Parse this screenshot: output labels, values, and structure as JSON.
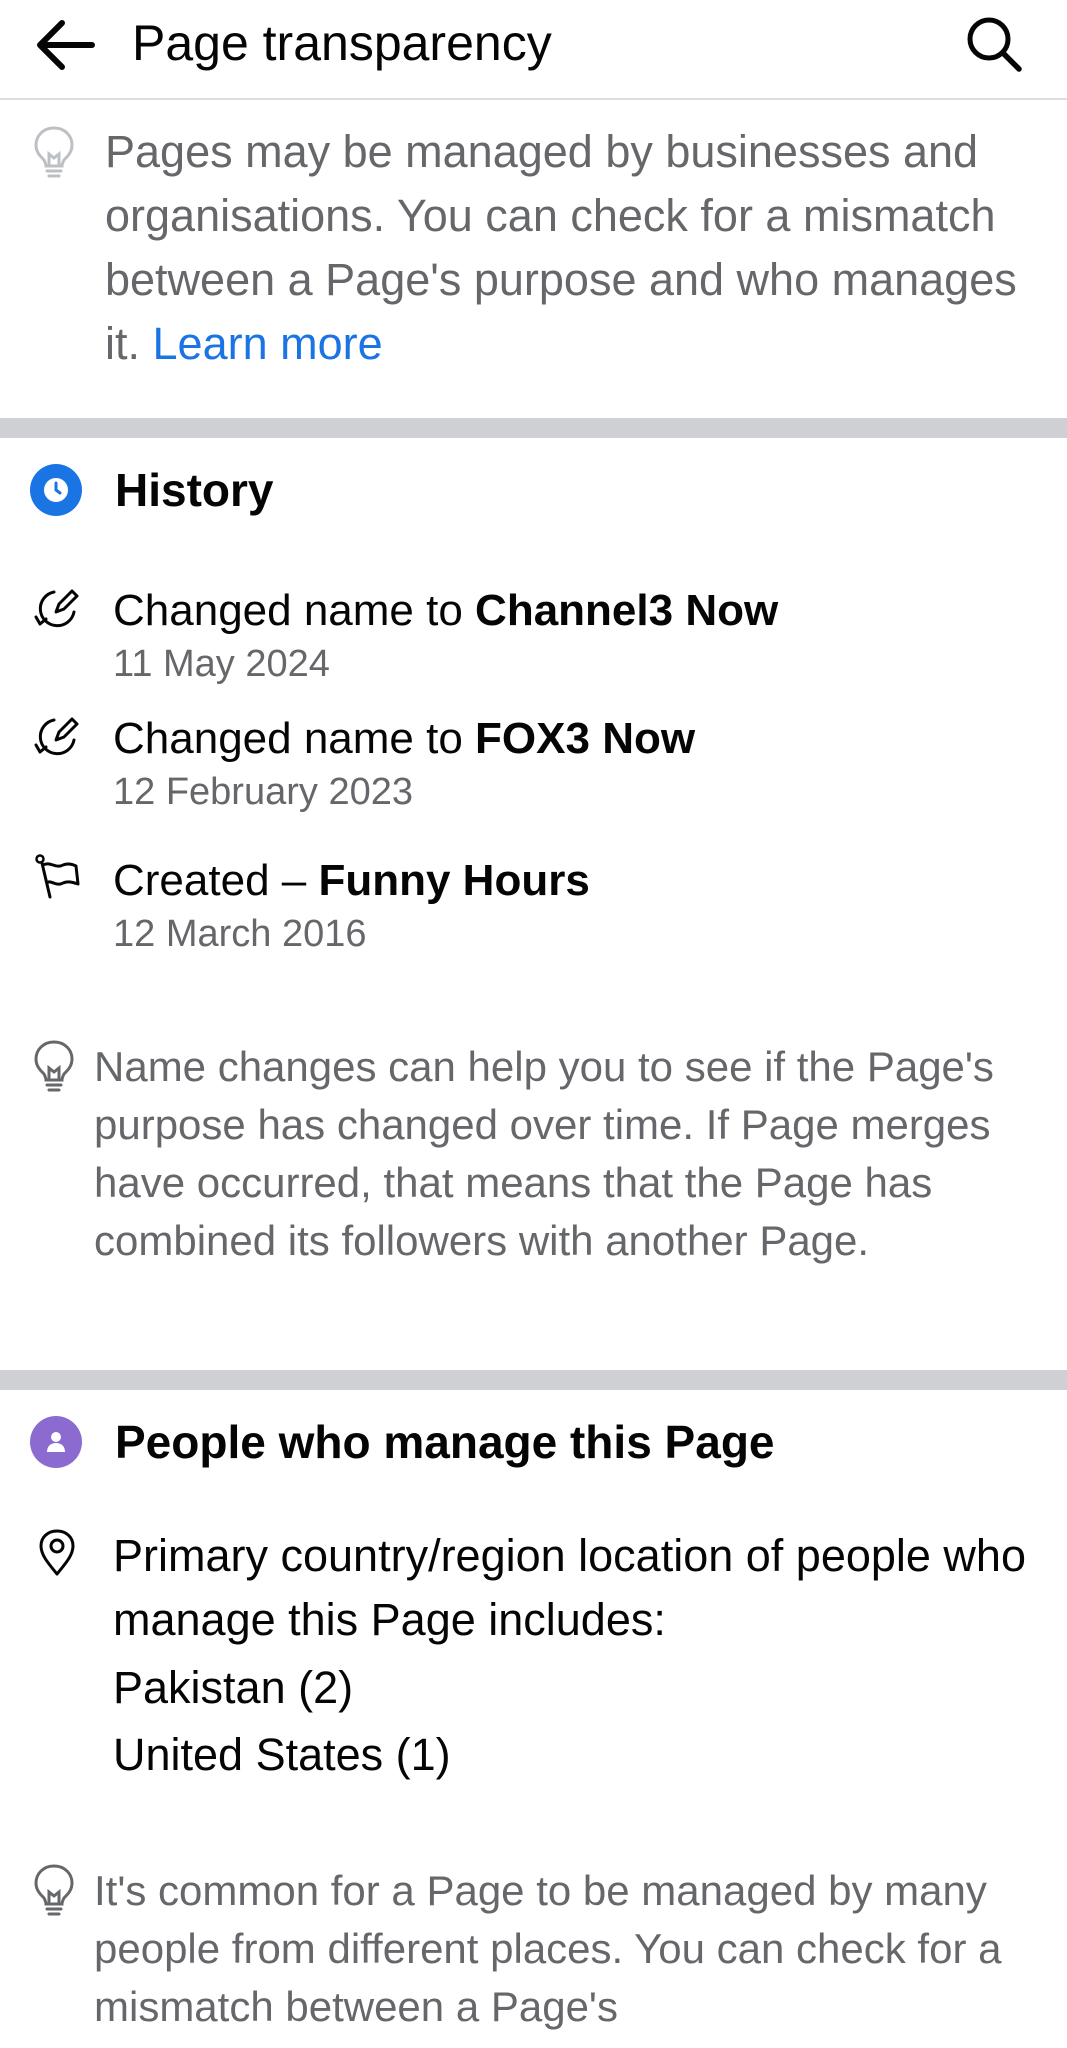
{
  "header": {
    "title": "Page transparency",
    "back_icon": "arrow-left-icon",
    "search_icon": "search-icon"
  },
  "intro": {
    "text": "Pages may be managed by businesses and organisations. You can check for a mismatch between a Page's purpose and who manages it.",
    "link_label": "Learn more",
    "icon": "lightbulb-icon"
  },
  "history": {
    "title": "History",
    "icon": "clock-icon",
    "accent": "#1b74e4",
    "items": [
      {
        "prefix": "Changed name to ",
        "name": "Channel3 Now",
        "date": "11 May 2024",
        "icon": "edit-circle-icon"
      },
      {
        "prefix": "Changed name to ",
        "name": "FOX3 Now",
        "date": "12 February 2023",
        "icon": "edit-circle-icon"
      },
      {
        "prefix": "Created – ",
        "name": "Funny Hours",
        "date": "12 March 2016",
        "icon": "flag-icon"
      }
    ],
    "tip": "Name changes can help you to see if the Page's purpose has changed over time. If Page merges have occurred, that means that the Page has combined its followers with another Page."
  },
  "managers": {
    "title": "People who manage this Page",
    "icon": "person-icon",
    "accent": "#8c6bd1",
    "location_label": "Primary country/region location of people who manage this Page includes:",
    "location_icon": "location-pin-icon",
    "countries": [
      "Pakistan (2)",
      "United States (1)"
    ],
    "tip": "It's common for a Page to be managed by many people from different places. You can check for a mismatch between a Page's"
  }
}
